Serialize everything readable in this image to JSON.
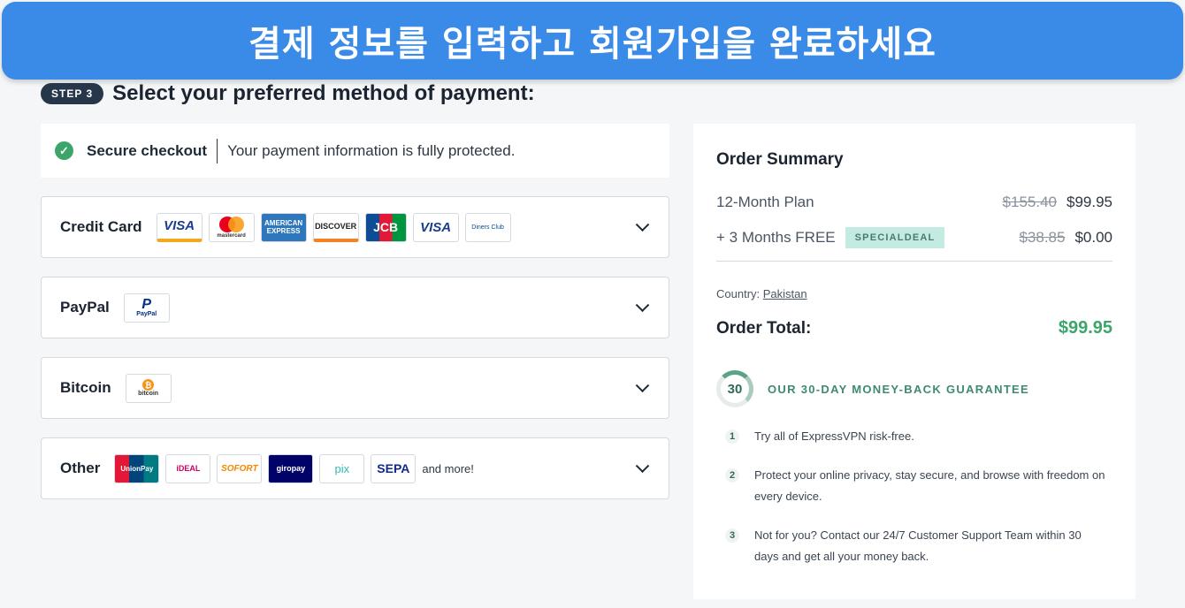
{
  "banner": {
    "text": "결제 정보를 입력하고 회원가입을 완료하세요"
  },
  "step": {
    "badge": "STEP 3",
    "title": "Select your preferred method of payment:"
  },
  "secure": {
    "title": "Secure checkout",
    "text": "Your payment information is fully protected."
  },
  "methods": {
    "credit_card": {
      "label": "Credit Card",
      "logos": [
        "VISA",
        "mastercard",
        "AMERICAN EXPRESS",
        "DISCOVER",
        "JCB",
        "VISA",
        "Diners Club"
      ]
    },
    "paypal": {
      "label": "PayPal",
      "logo": "PayPal"
    },
    "bitcoin": {
      "label": "Bitcoin",
      "logo": "bitcoin"
    },
    "other": {
      "label": "Other",
      "logos": [
        "UnionPay",
        "iDEAL",
        "SOFORT",
        "giropay",
        "pix",
        "SEPA"
      ],
      "more": "and more!"
    }
  },
  "summary": {
    "title": "Order Summary",
    "plan": {
      "label": "12-Month Plan",
      "old_price": "$155.40",
      "price": "$99.95"
    },
    "bonus": {
      "label": "+ 3 Months FREE",
      "badge": "SPECIALDEAL",
      "old_price": "$38.85",
      "price": "$0.00"
    },
    "country_label": "Country:",
    "country": "Pakistan",
    "total_label": "Order Total:",
    "total": "$99.95"
  },
  "guarantee": {
    "days": "30",
    "title": "OUR 30-DAY MONEY-BACK GUARANTEE",
    "items": [
      {
        "num": "1",
        "text": "Try all of ExpressVPN risk-free."
      },
      {
        "num": "2",
        "text": "Protect your online privacy, stay secure, and browse with freedom on every device."
      },
      {
        "num": "3",
        "text": "Not for you? Contact our 24/7 Customer Support Team within 30 days and get all your money back."
      }
    ]
  },
  "colors": {
    "banner": "#3a8ae8",
    "accent_green": "#3ca66a",
    "deal_bg": "#c4ebe1",
    "badge_dark": "#27374a"
  }
}
